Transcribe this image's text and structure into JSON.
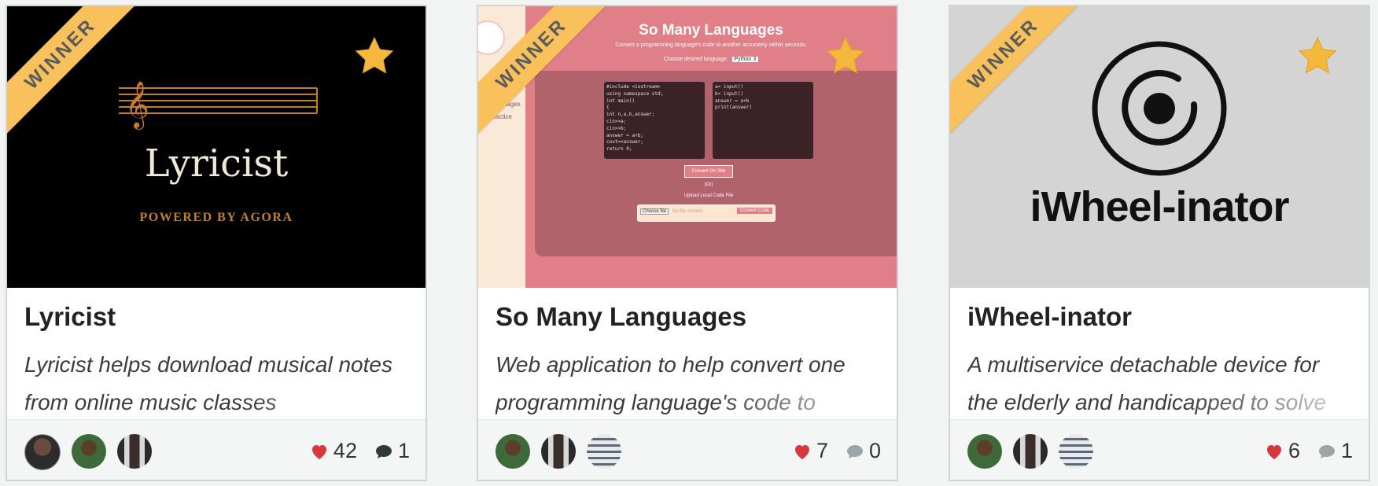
{
  "ribbon_label": "WINNER",
  "colors": {
    "ribbon": "#f8c15c",
    "star": "#f4b83c",
    "heart": "#d7373f",
    "comment_active": "#2f3a3a",
    "comment_empty": "#9aa6a8"
  },
  "cards": [
    {
      "title": "Lyricist",
      "description": "Lyricist helps download musical notes from online music classes",
      "thumb": {
        "logo_text": "Lyricist",
        "tagline": "POWERED BY AGORA"
      },
      "likes": "42",
      "comments": "1",
      "avatars": [
        "member-avatar-1",
        "member-avatar-2",
        "member-avatar-3"
      ]
    },
    {
      "title": "So Many Languages",
      "description": "Web application to help convert one programming language's code to",
      "thumb": {
        "app_title": "So Many Languages",
        "app_subtitle": "Convert a programming language's code to another accurately within seconds.",
        "language_label": "Choose desired language:",
        "language_value": "Python 3",
        "convert_btn": "Convert On Site",
        "or_label": "(Or)",
        "upload_label": "Upload Local Code File",
        "choose_file": "Choose file",
        "no_file": "No file chosen",
        "convert_code": "Convert Code",
        "sidebar_items": [
          "Languages",
          "Practice"
        ],
        "code_left": [
          "#include <iostream>",
          "using namespace std;",
          "int main()",
          "{",
          "int n,a,b,answer;",
          "cin>>a;",
          "cin>>b;",
          "answer = a+b;",
          "cout<<answer;",
          "return 0;"
        ],
        "code_right": [
          "a= input()",
          "b= input()",
          "answer = a+b",
          "print(answer)"
        ]
      },
      "likes": "7",
      "comments": "0",
      "avatars": [
        "member-avatar-1",
        "member-avatar-2",
        "member-avatar-3"
      ]
    },
    {
      "title": "iWheel-inator",
      "description": "A multiservice detachable device for the elderly and handicapped to solve",
      "thumb": {
        "logo_text": "iWheel-inator"
      },
      "likes": "6",
      "comments": "1",
      "avatars": [
        "member-avatar-1",
        "member-avatar-2",
        "member-avatar-3"
      ]
    }
  ]
}
